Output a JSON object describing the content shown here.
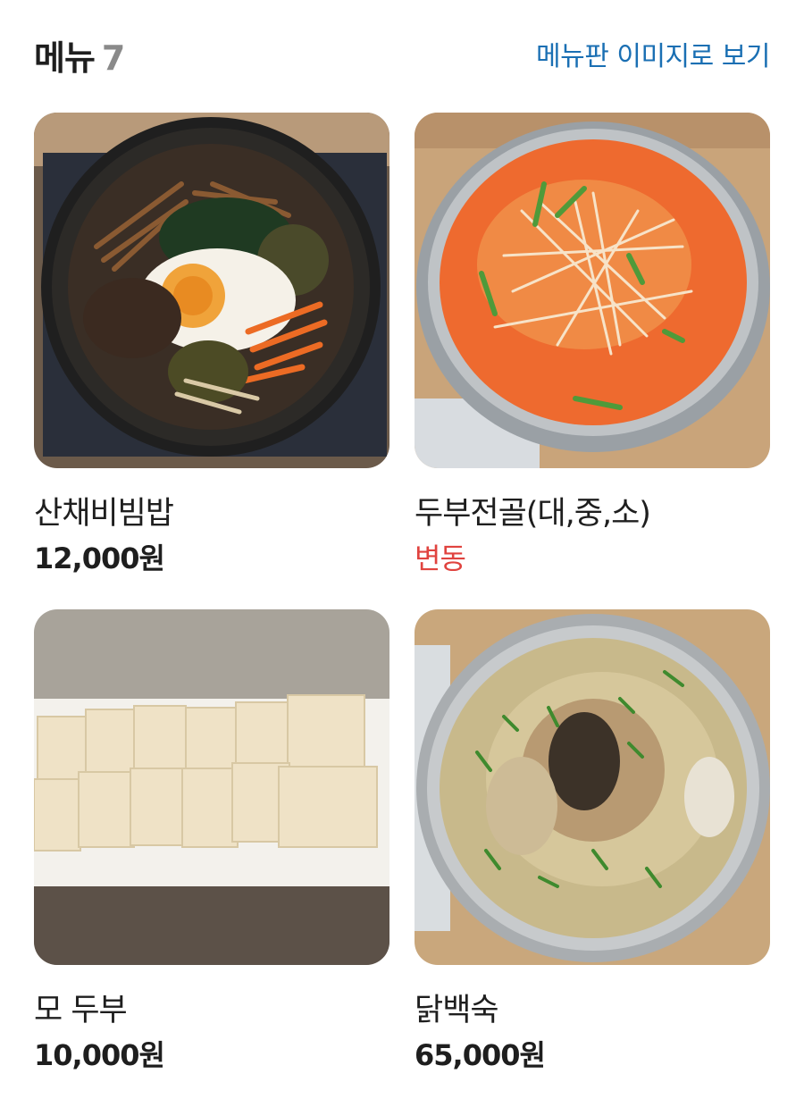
{
  "header": {
    "title": "메뉴",
    "count": "7",
    "view_image_link": "메뉴판 이미지로 보기"
  },
  "menu_items": [
    {
      "name": "산채비빔밥",
      "price": "12,000원",
      "photo_icon": "bibimbap-photo"
    },
    {
      "name": "두부전골(대,중,소)",
      "price": "변동",
      "price_color": "#e0433f",
      "photo_icon": "tofu-hotpot-photo"
    },
    {
      "name": "모 두부",
      "price": "10,000원",
      "photo_icon": "tofu-block-photo"
    },
    {
      "name": "닭백숙",
      "price": "65,000원",
      "photo_icon": "chicken-soup-photo"
    }
  ],
  "colors": {
    "link": "#1a6fb3",
    "price_varies": "#e0433f",
    "count": "#8a8a8a"
  }
}
